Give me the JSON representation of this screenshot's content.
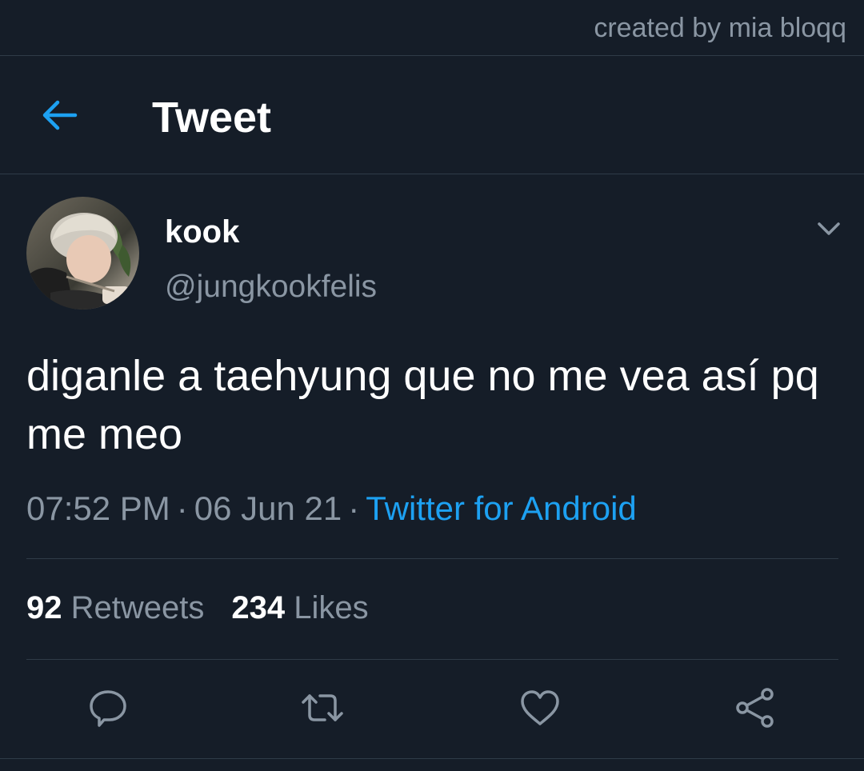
{
  "watermark": "created by mia bloqq",
  "header": {
    "title": "Tweet",
    "back_icon": "arrow-left-icon",
    "accent_color": "#1da1f2"
  },
  "tweet": {
    "display_name": "kook",
    "handle": "@jungkookfelis",
    "text": "diganle a taehyung que no me vea así pq me meo",
    "time": "07:52 PM",
    "separator": "·",
    "date": "06 Jun 21",
    "source": "Twitter for Android",
    "retweets_count": "92",
    "retweets_label": "Retweets",
    "likes_count": "234",
    "likes_label": "Likes"
  },
  "actions": [
    {
      "icon": "reply-icon"
    },
    {
      "icon": "retweet-icon"
    },
    {
      "icon": "like-icon"
    },
    {
      "icon": "share-icon"
    }
  ],
  "colors": {
    "background": "#151d28",
    "divider": "#2f3b48",
    "secondary_text": "#8a96a3",
    "link": "#1da1f2"
  }
}
